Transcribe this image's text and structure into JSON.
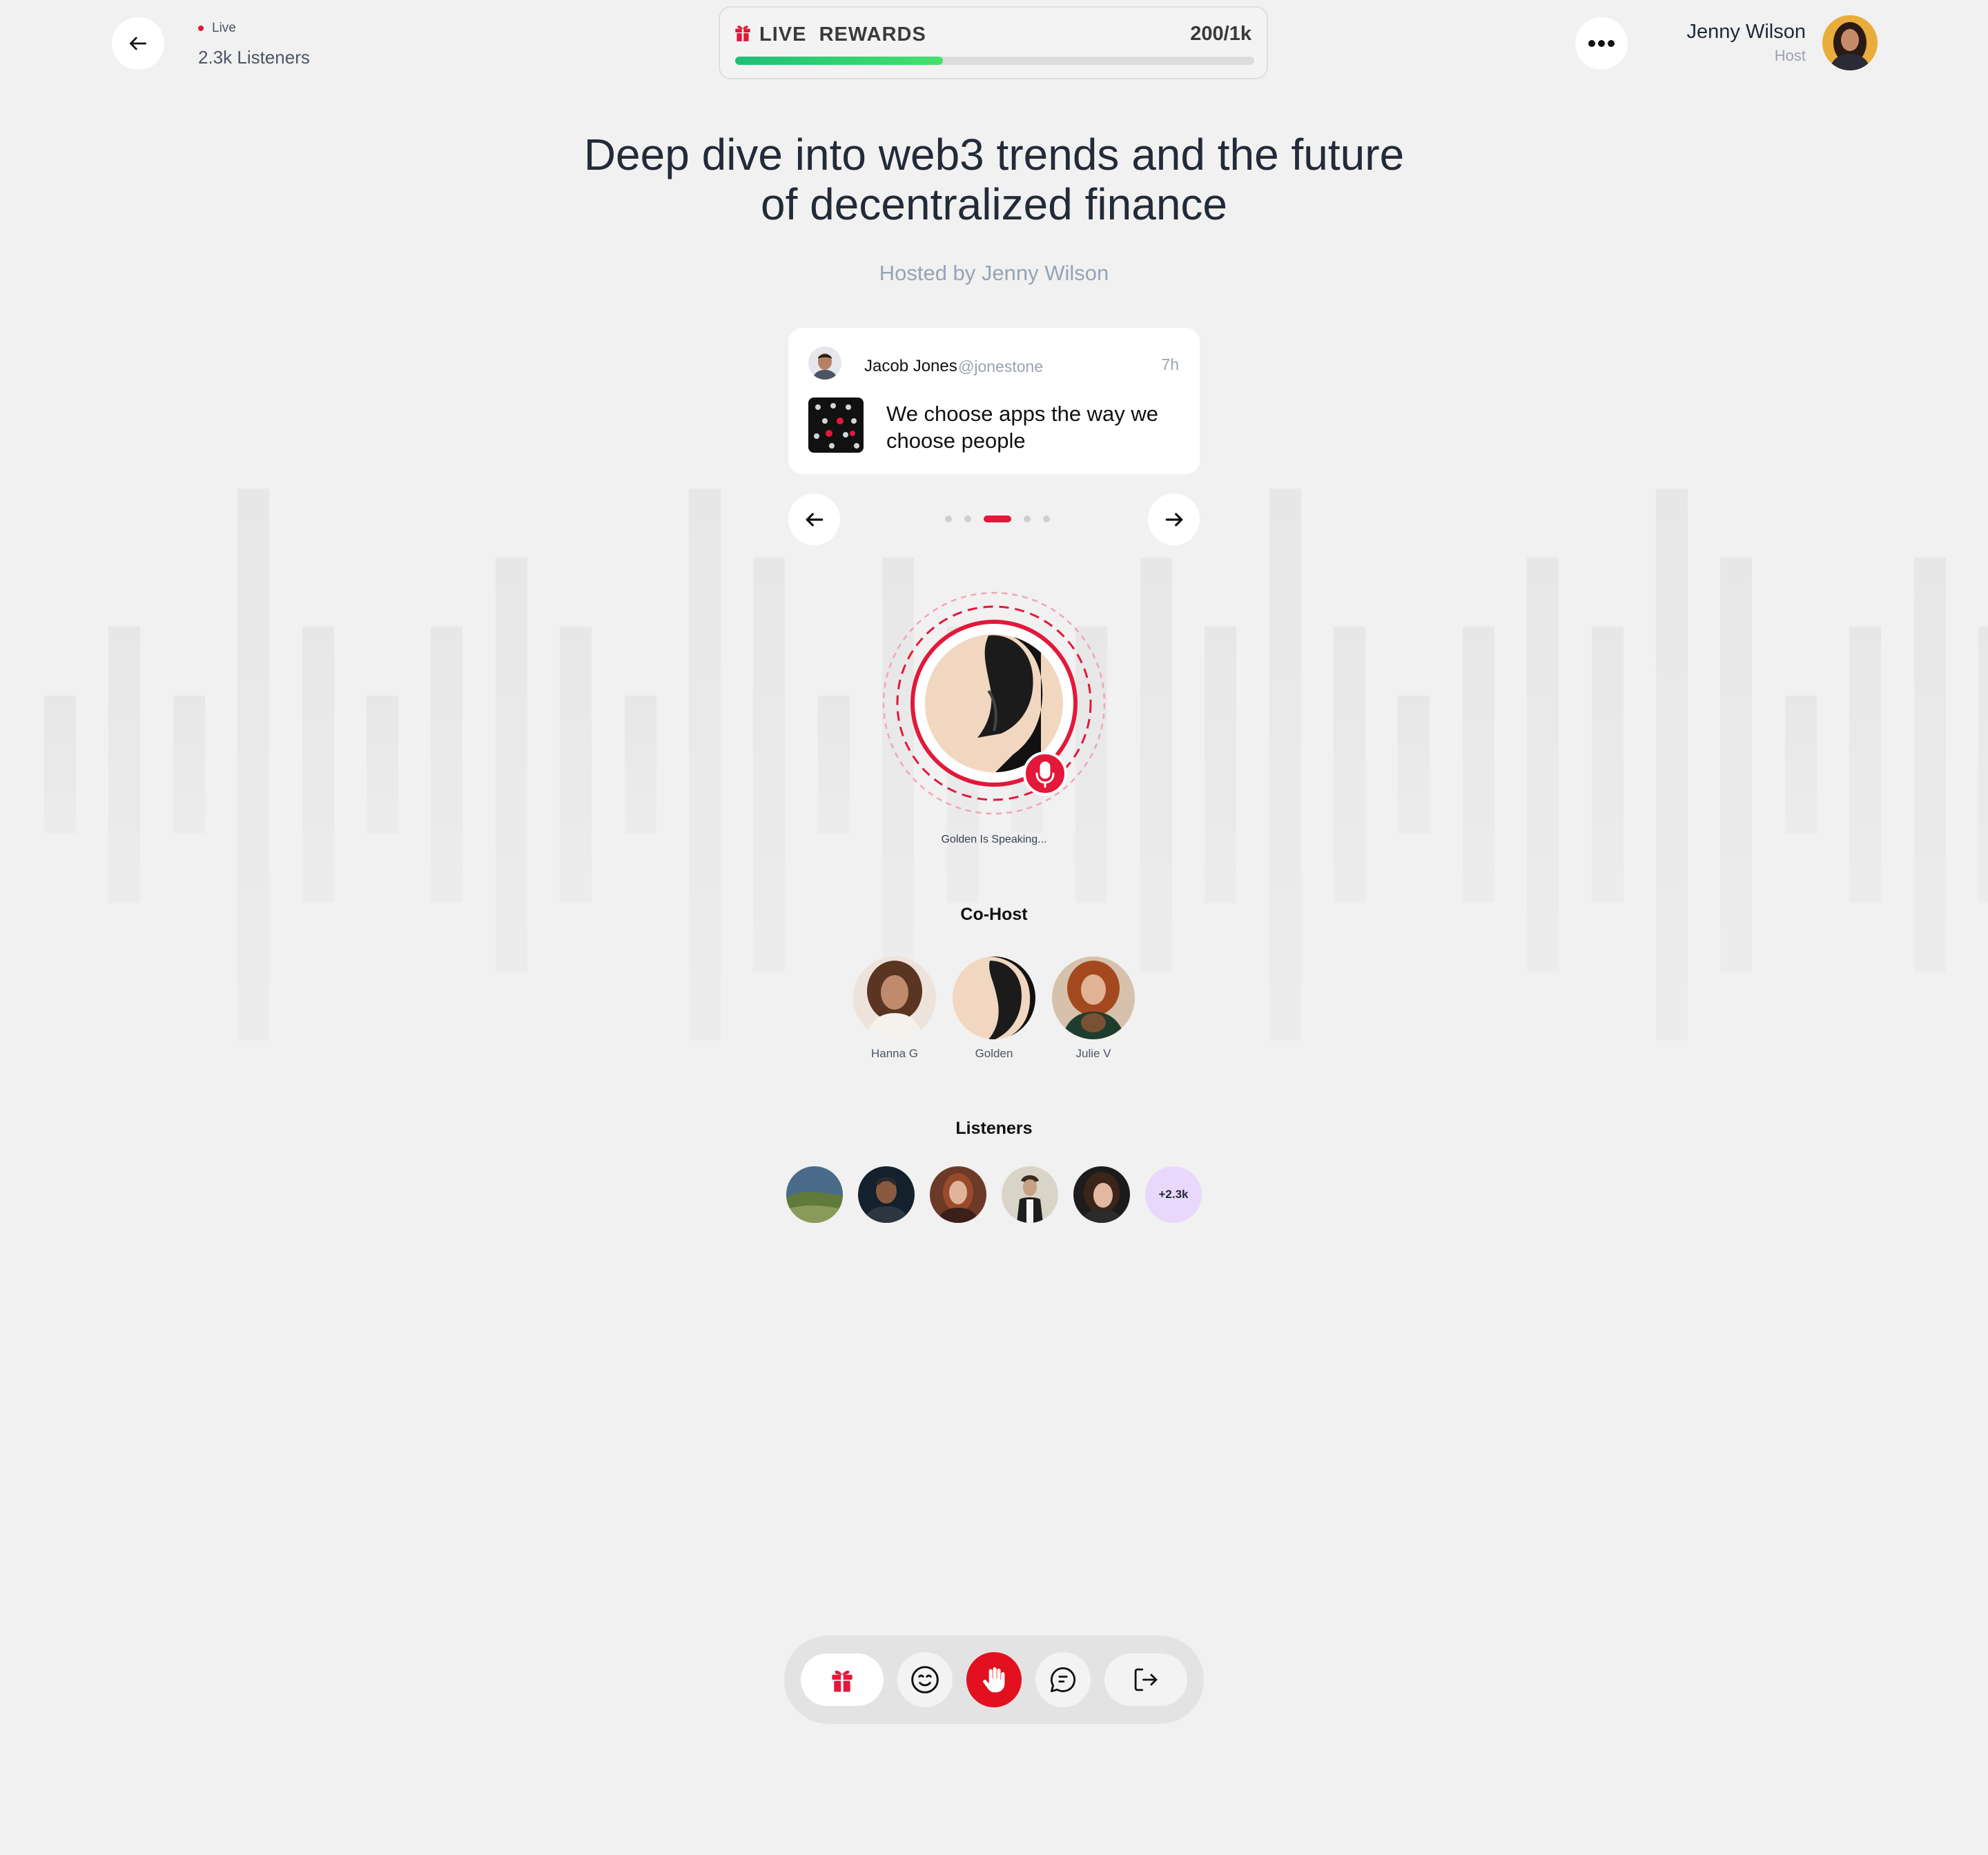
{
  "header": {
    "live_label": "Live",
    "listeners_count": "2.3k Listeners",
    "host_name": "Jenny Wilson",
    "host_role": "Host"
  },
  "rewards": {
    "title": "LIVE  REWARDS",
    "progress_text": "200/1k",
    "progress_fraction": 0.4
  },
  "room": {
    "title": "Deep dive into web3 trends and the future of decentralized finance",
    "hosted_by": "Hosted by Jenny Wilson"
  },
  "post": {
    "author": "Jacob Jones",
    "handle": "@jonestone",
    "time": "7h",
    "text": "We choose apps the way we choose people"
  },
  "carousel": {
    "total_dots": 5,
    "active_index": 2
  },
  "speaker": {
    "status": "Golden Is Speaking..."
  },
  "cohosts": {
    "heading": "Co-Host",
    "items": [
      {
        "name": "Hanna G"
      },
      {
        "name": "Golden"
      },
      {
        "name": "Julie V"
      }
    ]
  },
  "listeners": {
    "heading": "Listeners",
    "more": "+2.3k"
  },
  "colors": {
    "accent": "#e3183a",
    "progress": "#2fcf72",
    "background": "#f1f1f1",
    "more_badge": "#ead8fc"
  },
  "icons": {
    "back": "arrow-left-icon",
    "more": "more-horizontal-icon",
    "gift": "gift-icon",
    "mic": "microphone-icon",
    "emoji": "smile-icon",
    "hand": "raise-hand-icon",
    "chat": "chat-bubble-icon",
    "leave": "log-out-icon"
  }
}
